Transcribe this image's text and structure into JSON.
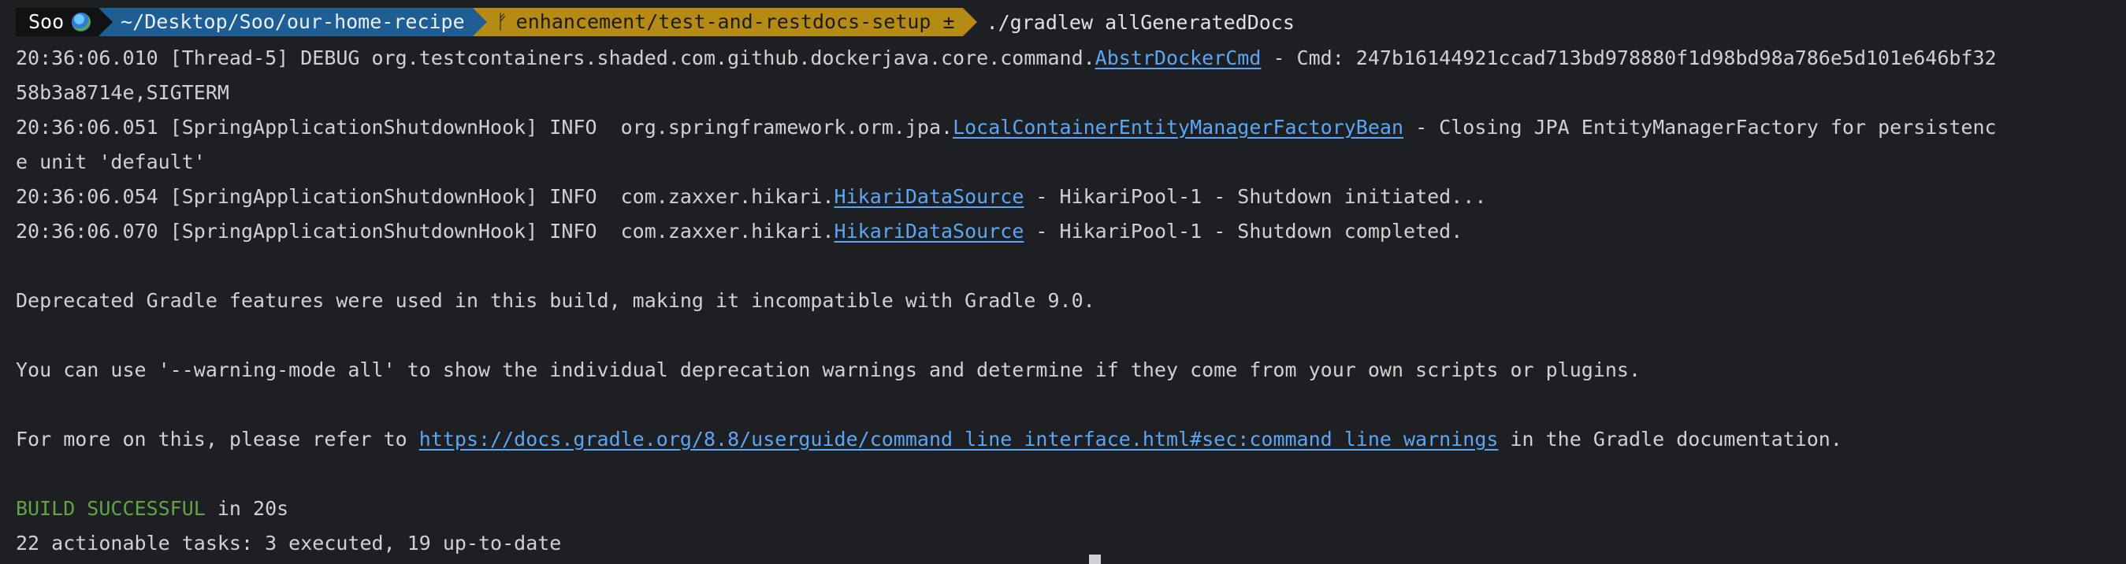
{
  "prompt": {
    "user": "Soo",
    "globe_icon": "globe-icon",
    "directory": "~/Desktop/Soo/our-home-recipe",
    "branch": "enhancement/test-and-restdocs-setup ±",
    "branch_icon": "git-branch-icon",
    "command": "./gradlew allGeneratedDocs",
    "colors": {
      "user_bg": "#111214",
      "dir_bg": "#1f5e92",
      "git_bg": "#b58b16"
    }
  },
  "log": [
    {
      "prefix": "20:36:06.010 [Thread-5] DEBUG org.testcontainers.shaded.com.github.dockerjava.core.command.",
      "link": "AbstrDockerCmd",
      "suffix": " - Cmd: 247b16144921ccad713bd978880f1d98bd98a786e5d101e646bf32",
      "continuation": "58b3a8714e,SIGTERM"
    },
    {
      "prefix": "20:36:06.051 [SpringApplicationShutdownHook] INFO  org.springframework.orm.jpa.",
      "link": "LocalContainerEntityManagerFactoryBean",
      "suffix": " - Closing JPA EntityManagerFactory for persistenc",
      "continuation": "e unit 'default'"
    },
    {
      "prefix": "20:36:06.054 [SpringApplicationShutdownHook] INFO  com.zaxxer.hikari.",
      "link": "HikariDataSource",
      "suffix": " - HikariPool-1 - Shutdown initiated..."
    },
    {
      "prefix": "20:36:06.070 [SpringApplicationShutdownHook] INFO  com.zaxxer.hikari.",
      "link": "HikariDataSource",
      "suffix": " - HikariPool-1 - Shutdown completed."
    }
  ],
  "messages": {
    "deprecated": "Deprecated Gradle features were used in this build, making it incompatible with Gradle 9.0.",
    "warning_mode": "You can use '--warning-mode all' to show the individual deprecation warnings and determine if they come from your own scripts or plugins.",
    "refer_prefix": "For more on this, please refer to ",
    "refer_link": "https://docs.gradle.org/8.8/userguide/command_line_interface.html#sec:command_line_warnings",
    "refer_suffix": " in the Gradle documentation.",
    "build_status": "BUILD SUCCESSFUL",
    "build_time": " in 20s",
    "tasks": "22 actionable tasks: 3 executed, 19 up-to-date",
    "success_color": "#5fa548",
    "link_color": "#5ba6f5"
  }
}
